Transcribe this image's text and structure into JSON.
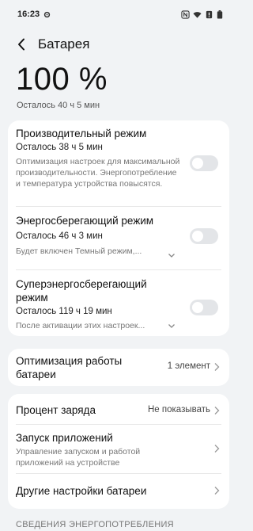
{
  "status_bar": {
    "time": "16:23",
    "icons": [
      "gear-icon",
      "nfc-icon",
      "wifi-icon",
      "battery-saver-icon",
      "battery-icon"
    ]
  },
  "header": {
    "title": "Батарея"
  },
  "battery": {
    "percent": "100 %",
    "remaining": "Осталось 40 ч 5 мин"
  },
  "modes": [
    {
      "title": "Производительный режим",
      "remaining": "Осталось 38 ч 5 мин",
      "description": "Оптимизация настроек для максимальной производительности. Энергопотребление и температура устройства повысятся.",
      "enabled": false
    },
    {
      "title": "Энергосберегающий режим",
      "remaining": "Осталось 46 ч 3 мин",
      "description": "Будет включен Темный режим,...",
      "enabled": false
    },
    {
      "title": "Суперэнергосберегающий режим",
      "remaining": "Осталось 119 ч 19 мин",
      "description": "После активации этих настроек...",
      "enabled": false
    }
  ],
  "optimization": {
    "title": "Оптимизация работы батареи",
    "value": "1 элемент"
  },
  "settings": [
    {
      "title": "Процент заряда",
      "value": "Не показывать"
    },
    {
      "title": "Запуск приложений",
      "description": "Управление запуском и работой приложений на устройстве"
    },
    {
      "title": "Другие настройки батареи"
    }
  ],
  "section_header": "СВЕДЕНИЯ ЭНЕРГОПОТРЕБЛЕНИЯ"
}
